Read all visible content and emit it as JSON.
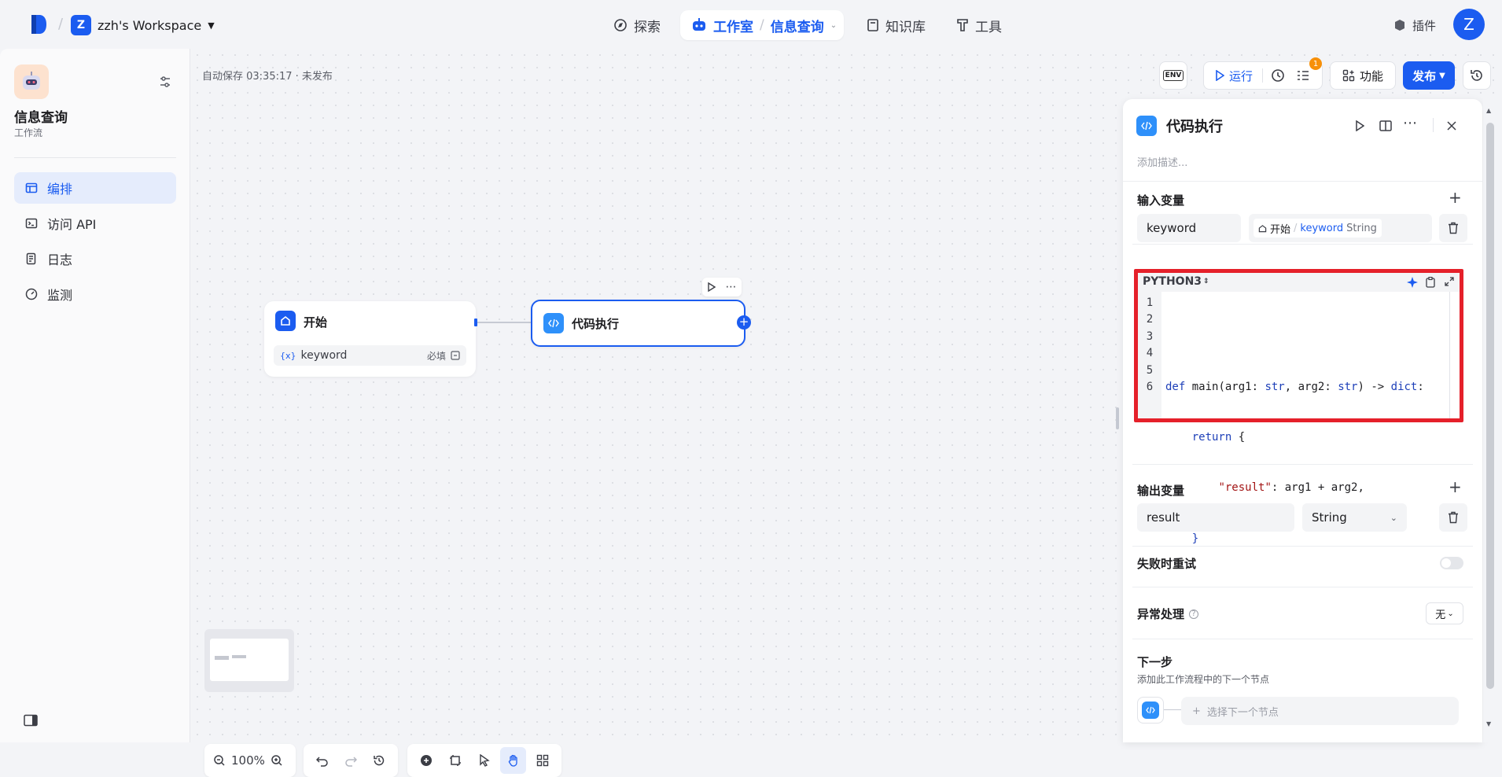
{
  "topbar": {
    "workspace_initial": "Z",
    "workspace_name": "zzh's Workspace",
    "nav": {
      "explore": "探索",
      "studio": "工作室",
      "current": "信息查询",
      "knowledge": "知识库",
      "tools": "工具"
    },
    "plugins": "插件",
    "avatar": "Z"
  },
  "sidebar": {
    "app_name": "信息查询",
    "app_type": "工作流",
    "items": [
      {
        "label": "编排",
        "icon": "layout-icon",
        "active": true
      },
      {
        "label": "访问 API",
        "icon": "terminal-icon",
        "active": false
      },
      {
        "label": "日志",
        "icon": "log-icon",
        "active": false
      },
      {
        "label": "监测",
        "icon": "monitor-icon",
        "active": false
      }
    ]
  },
  "canvas": {
    "autosave": "自动保存 03:35:17 · 未发布",
    "env_label": "ENV",
    "run": "运行",
    "badge": "1",
    "features": "功能",
    "publish": "发布",
    "zoom": "100%",
    "start_node": {
      "title": "开始",
      "var_icon": "{x}",
      "var": "keyword",
      "required": "必填"
    },
    "code_node": {
      "title": "代码执行"
    }
  },
  "panel": {
    "title": "代码执行",
    "description_placeholder": "添加描述...",
    "inputs_title": "输入变量",
    "input_var_name": "keyword",
    "input_ref_node": "开始",
    "input_ref_var": "keyword",
    "input_ref_type": "String",
    "language": "PYTHON3",
    "code_lines": [
      {
        "n": "1",
        "text": ""
      },
      {
        "n": "2",
        "text": "def main(arg1: str, arg2: str) -> dict:"
      },
      {
        "n": "3",
        "text": "    return {"
      },
      {
        "n": "4",
        "text": "        \"result\": arg1 + arg2,"
      },
      {
        "n": "5",
        "text": "    }"
      },
      {
        "n": "6",
        "text": ""
      }
    ],
    "outputs_title": "输出变量",
    "output_var_name": "result",
    "output_type": "String",
    "retry_label": "失败时重试",
    "error_label": "异常处理",
    "error_value": "无",
    "next_title": "下一步",
    "next_desc": "添加此工作流程中的下一个节点",
    "next_select": "选择下一个节点"
  },
  "colors": {
    "accent": "#1b5cf0",
    "highlight_border": "#e5202a"
  }
}
